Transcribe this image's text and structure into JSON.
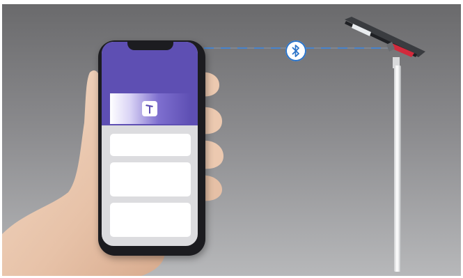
{
  "scene": {
    "connection_icon": "bluetooth-icon",
    "app_icon": "street-lamp-icon",
    "colors": {
      "app_purple": "#5e4fb3",
      "link_blue": "#2a73c9",
      "lamp_accent": "#d22a3c",
      "card_white": "#ffffff",
      "screen_gray": "#dcdcdf"
    }
  }
}
